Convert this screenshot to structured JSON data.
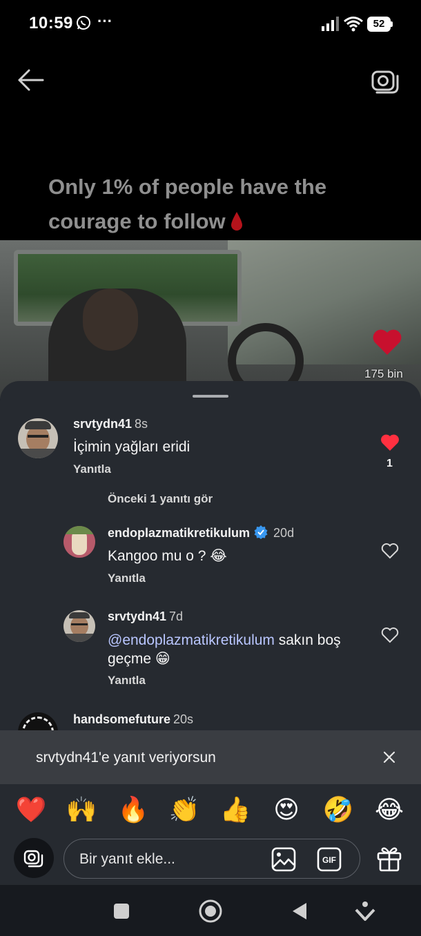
{
  "status_bar": {
    "time": "10:59",
    "more": "···",
    "battery": "52"
  },
  "video": {
    "caption": "Only 1% of people have the courage to follow",
    "like_count": "175 bin"
  },
  "comments": [
    {
      "username": "srvtydn41",
      "time": "8s",
      "text": "İçimin yağları eridi",
      "reply_label": "Yanıtla",
      "like_count": "1"
    },
    {
      "username": "endoplazmatikretikulum",
      "time": "20d",
      "text": "Kangoo mu o ? 😂",
      "reply_label": "Yanıtla"
    },
    {
      "username": "srvtydn41",
      "time": "7d",
      "mention": "@endoplazmatikretikulum",
      "text": " sakın boş geçme 😁",
      "reply_label": "Yanıtla"
    },
    {
      "username": "handsomefuture",
      "time": "20s"
    }
  ],
  "view_previous": "Önceki 1 yanıtı gör",
  "reply_banner": {
    "text": "srvtydn41'e yanıt veriyorsun"
  },
  "emojis": [
    "❤️",
    "🙌",
    "🔥",
    "👏",
    "👍",
    "😍",
    "🤣",
    "😂"
  ],
  "composer": {
    "placeholder": "Bir yanıt ekle...",
    "gif_label": "GIF"
  },
  "colors": {
    "sheet_bg": "#262a30",
    "like_red": "#ff3040",
    "verified_blue": "#3897f0"
  }
}
